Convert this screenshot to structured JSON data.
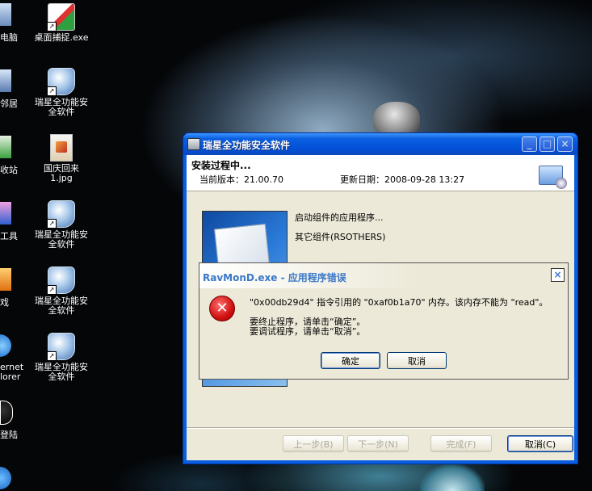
{
  "desktop": {
    "icons": [
      {
        "label": "桌面捕捉.exe"
      },
      {
        "label": "瑞星全功能安全软件"
      },
      {
        "label": "国庆回来1.jpg"
      },
      {
        "label": "瑞星全功能安全软件"
      },
      {
        "label": "瑞星全功能安全软件"
      },
      {
        "label": "瑞星全功能安全软件"
      }
    ],
    "partial_labels": [
      "电脑",
      "邻居",
      "收站",
      "工具",
      "戏",
      "ernet",
      "lorer",
      "登陆"
    ]
  },
  "installer": {
    "title": "瑞星全功能安全软件",
    "heading": "安装过程中...",
    "version": "当前版本：21.00.70",
    "update_date": "更新日期：2008-09-28 13:27",
    "status_line1": "启动组件的应用程序...",
    "status_line2": "其它组件(RSOTHERS)",
    "buttons": {
      "back": "上一步(B)",
      "next": "下一步(N)",
      "finish": "完成(F)",
      "cancel": "取消(C)"
    },
    "caption_buttons": {
      "minimize": "_",
      "maximize": "□",
      "close": "×"
    }
  },
  "error_dialog": {
    "title": "RavMonD.exe - 应用程序错误",
    "message": "\"0x00db29d4\" 指令引用的 \"0xaf0b1a70\" 内存。该内存不能为 \"read\"。",
    "line1": "要终止程序，请单击“确定”。",
    "line2": "要调试程序，请单击“取消”。",
    "ok": "确定",
    "cancel": "取消",
    "close": "×"
  }
}
